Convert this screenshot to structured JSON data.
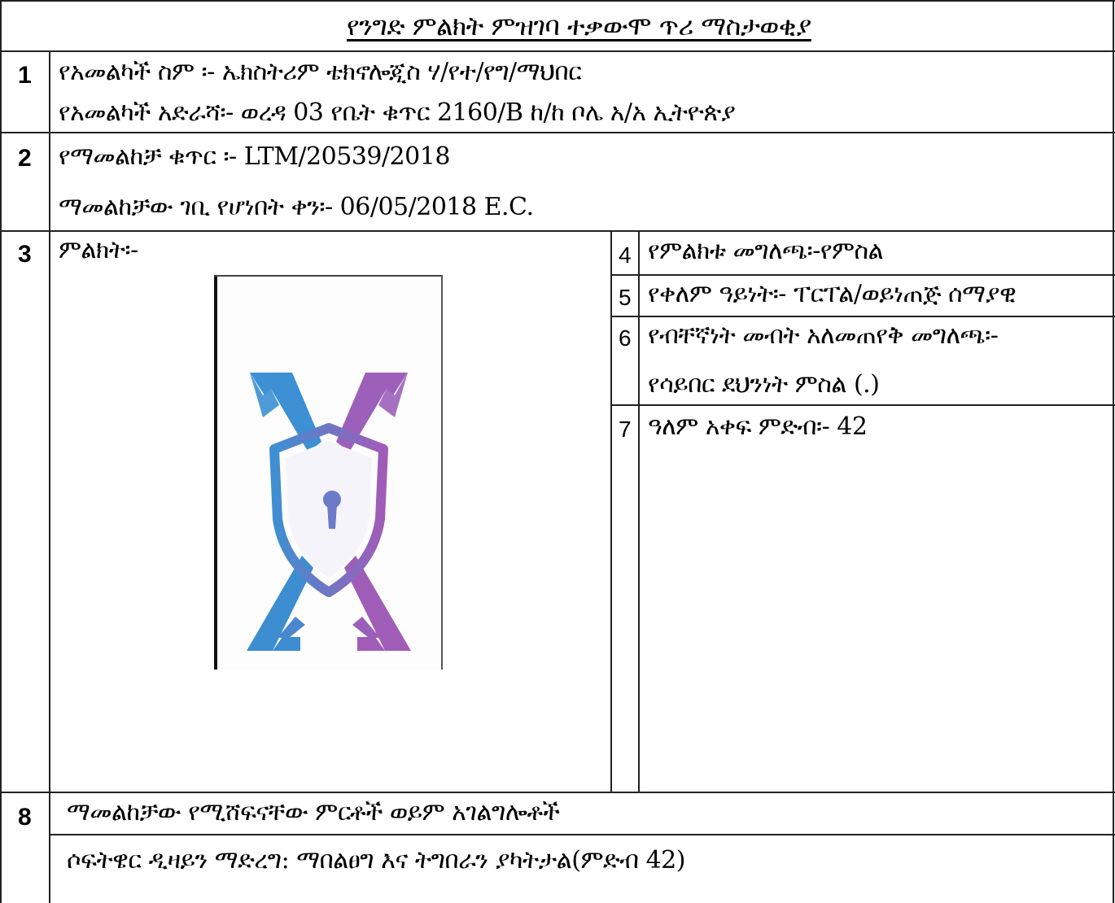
{
  "title": "የንግድ ምልክት ምዝገባ ተቃውሞ ጥሪ ማስታወቂያ",
  "rows": {
    "r1": {
      "number": "1",
      "owner_name": "የአመልካች ስም ፡- ኤክስትሪም ቴክኖሎጂስ ሃ/የተ/የግ/ማህበር",
      "owner_address": "የአመልካች አድራሻ፡- ወረዳ 03 የቤት ቁጥር 2160/B ከ/ከ ቦሌ አ/አ ኢትዮጵያ"
    },
    "r2": {
      "number": "2",
      "application_number": "የማመልከቻ ቁጥር ፡- LTM/20539/2018",
      "filing_date": "ማመልከቻው ገቢ የሆነበት ቀን፡- 06/05/2018 E.C."
    },
    "r3": {
      "number": "3",
      "mark_label": "ምልክት፡-"
    },
    "r4": {
      "number": "4",
      "mark_description": "የምልክቱ መግለጫ፡-የምስል"
    },
    "r5": {
      "number": "5",
      "color_type": "የቀለም ዓይነት፡- ፐርፐል/ወይነጠጅ ሰማያዊ"
    },
    "r6": {
      "number": "6",
      "disclaimer_label": "የብቸኛነት መብት አለመጠየቅ መግለጫ፡-",
      "disclaimer_value": "የሳይበር ደህንነት ምስል (.)"
    },
    "r7": {
      "number": "7",
      "nice_class": "ዓለም አቀፍ ምድብ፡- 42"
    },
    "r8": {
      "number": "8",
      "goods_label": "ማመልከቻው የሚሸፍናቸው ምርቶች ወይም አገልግሎቶች",
      "goods_value": "ሶፍትዌር ዲዛይን ማድረግ: ማበልፀግ እና ትግበራን ያካትታል(ምድብ 42)"
    }
  },
  "logo": {
    "icon": "x-shield-keyhole-logo",
    "colors": {
      "blue": "#3b8fd1",
      "purple": "#9a5fb8",
      "mid": "#6f78c6"
    }
  }
}
